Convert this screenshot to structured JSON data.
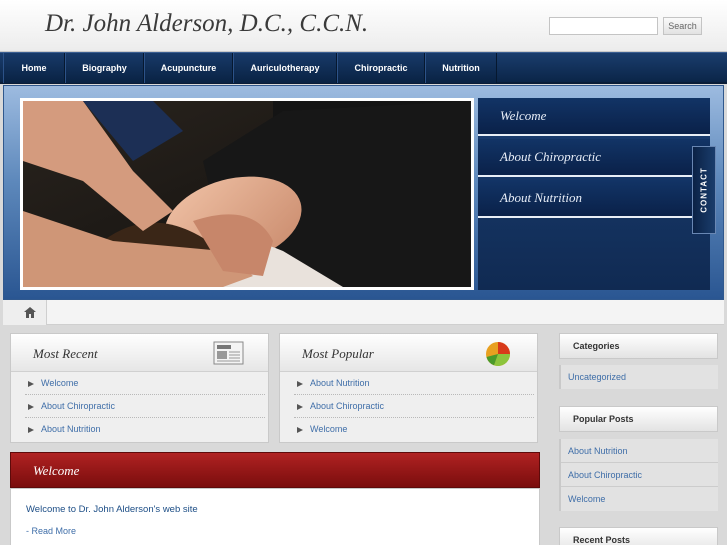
{
  "header": {
    "site_title": "Dr. John Alderson, D.C., C.C.N.",
    "search_placeholder": "",
    "search_button": "Search"
  },
  "nav": {
    "items": [
      {
        "label": "Home"
      },
      {
        "label": "Biography"
      },
      {
        "label": "Acupuncture"
      },
      {
        "label": "Auriculotherapy"
      },
      {
        "label": "Chiropractic"
      },
      {
        "label": "Nutrition"
      }
    ]
  },
  "hero": {
    "menu": [
      {
        "label": "Welcome"
      },
      {
        "label": "About Chiropractic"
      },
      {
        "label": "About Nutrition"
      }
    ],
    "contact_tab": "CONTACT"
  },
  "most_recent": {
    "title": "Most Recent",
    "items": [
      "Welcome",
      "About Chiropractic",
      "About Nutrition"
    ],
    "icon": "news-icon"
  },
  "most_popular": {
    "title": "Most Popular",
    "items": [
      "About Nutrition",
      "About Chiropractic",
      "Welcome"
    ],
    "icon": "pie-chart-icon"
  },
  "welcome": {
    "title": "Welcome",
    "text": "Welcome to Dr. John Alderson's web site",
    "read_more": "- Read More"
  },
  "sidebar": {
    "categories_title": "Categories",
    "categories": [
      "Uncategorized"
    ],
    "popular_title": "Popular Posts",
    "popular": [
      "About Nutrition",
      "About Chiropractic",
      "Welcome"
    ],
    "recent_title": "Recent Posts"
  },
  "colors": {
    "nav_bg": "#0b2548",
    "link": "#3f6ea8",
    "welcome_red": "#9a1515"
  }
}
